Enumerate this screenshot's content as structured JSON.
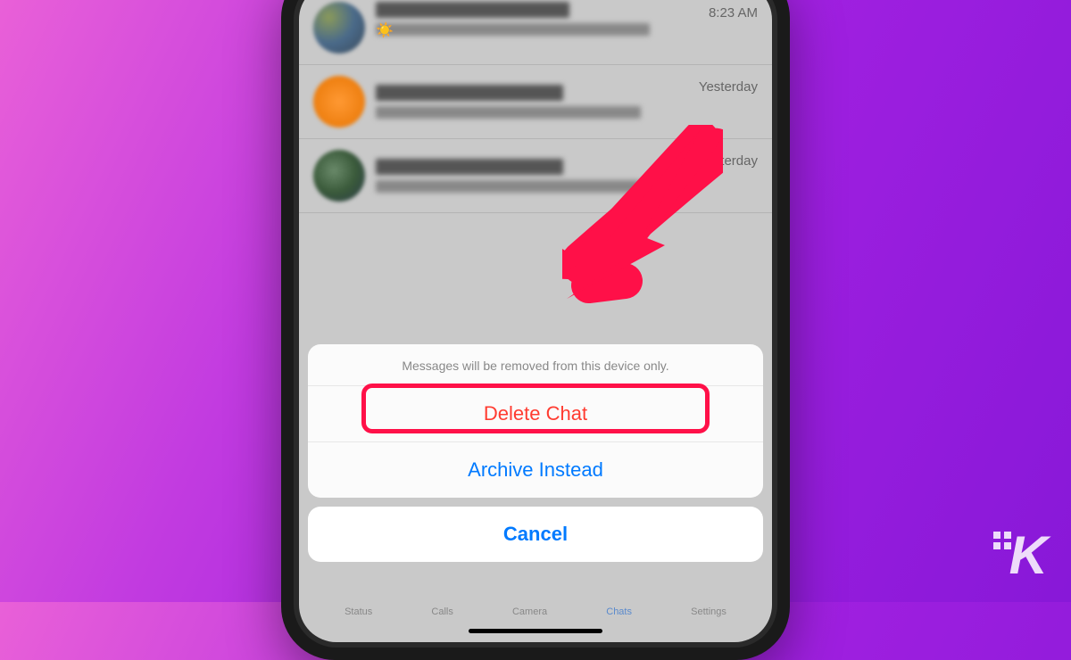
{
  "chats": [
    {
      "time": "8:23 AM"
    },
    {
      "time": "Yesterday"
    },
    {
      "time": "Yesterday"
    }
  ],
  "sheet": {
    "message": "Messages will be removed from this device only.",
    "delete": "Delete Chat",
    "archive": "Archive Instead",
    "cancel": "Cancel"
  },
  "tabs": {
    "status": "Status",
    "calls": "Calls",
    "camera": "Camera",
    "chats": "Chats",
    "settings": "Settings"
  },
  "colors": {
    "destructive": "#ff3b30",
    "primary": "#007aff",
    "highlight": "#ff1048"
  }
}
